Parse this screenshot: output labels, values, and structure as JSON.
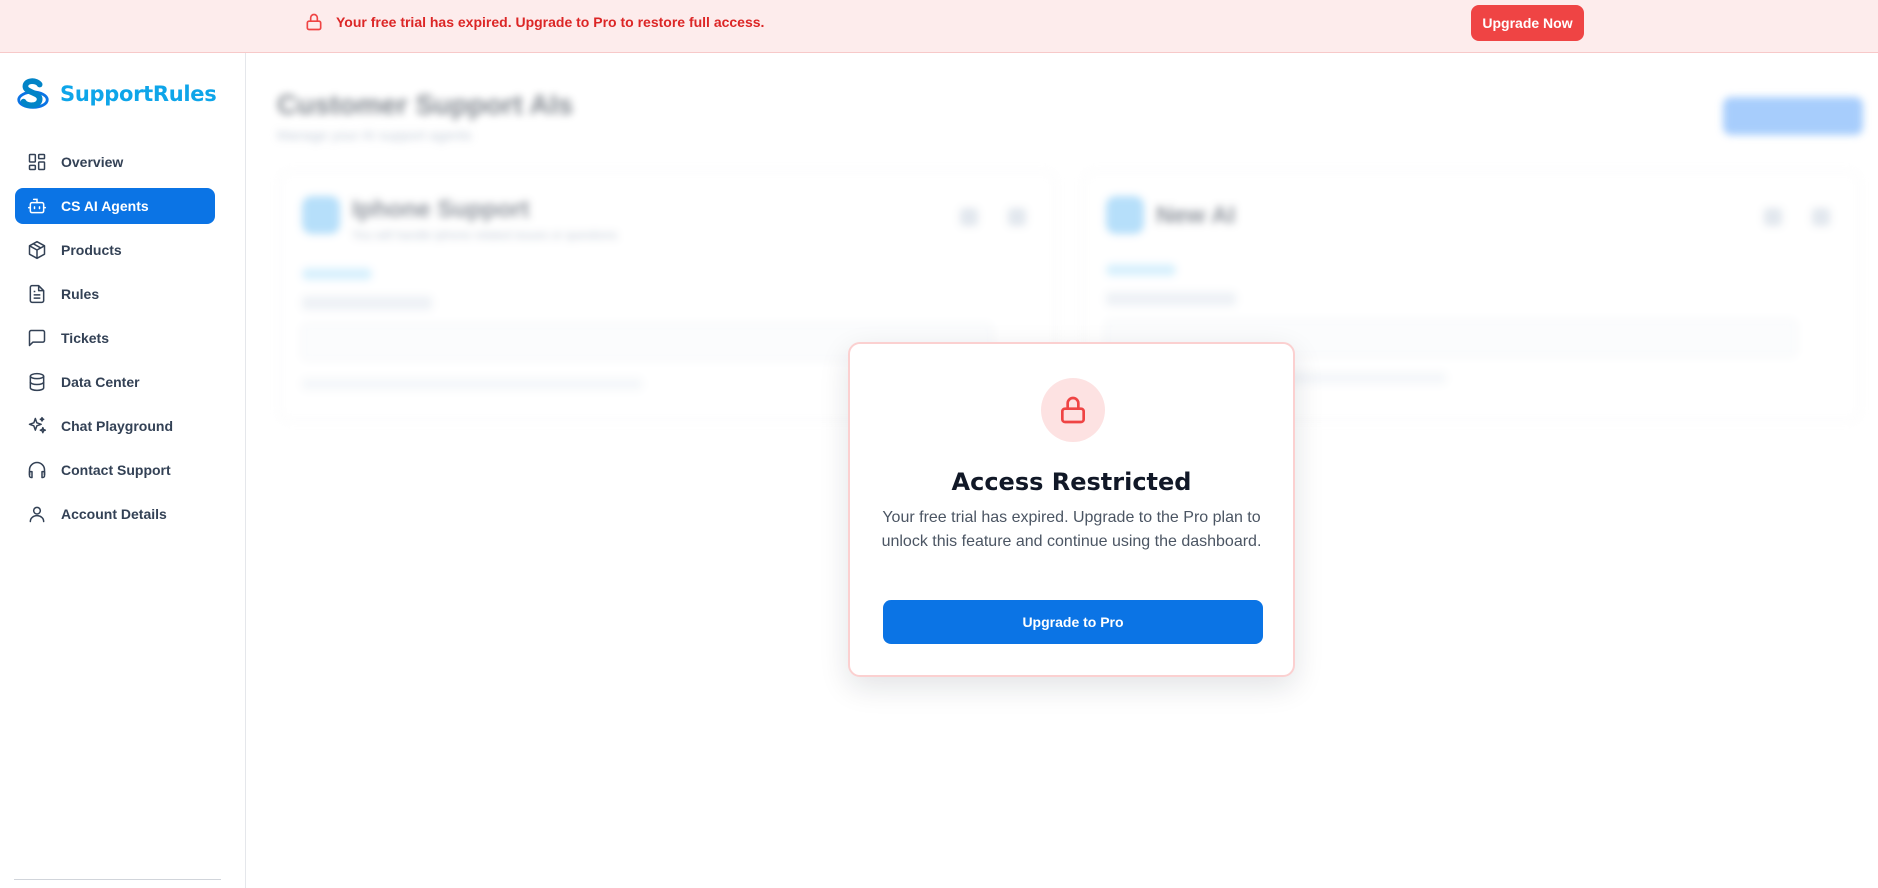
{
  "banner": {
    "message": "Your free trial has expired. Upgrade to Pro to restore full access.",
    "cta_label": "Upgrade Now",
    "color": "#dc2626"
  },
  "brand": {
    "name": "SupportRules",
    "color": "#0ea5e9"
  },
  "sidebar": {
    "items": [
      {
        "label": "Overview",
        "icon": "grid-icon",
        "active": false
      },
      {
        "label": "CS AI Agents",
        "icon": "bot-icon",
        "active": true
      },
      {
        "label": "Products",
        "icon": "box-icon",
        "active": false
      },
      {
        "label": "Rules",
        "icon": "document-icon",
        "active": false
      },
      {
        "label": "Tickets",
        "icon": "chat-bubble-icon",
        "active": false
      },
      {
        "label": "Data Center",
        "icon": "database-icon",
        "active": false
      },
      {
        "label": "Chat Playground",
        "icon": "sparkles-icon",
        "active": false
      },
      {
        "label": "Contact Support",
        "icon": "headphones-icon",
        "active": false
      },
      {
        "label": "Account Details",
        "icon": "user-icon",
        "active": false
      }
    ]
  },
  "main": {
    "title": "Customer Support AIs",
    "subtitle": "Manage your AI support agents",
    "cards": [
      {
        "name": "Iphone Support",
        "description": "You will handle iphone related issues or questions"
      },
      {
        "name": "New AI",
        "description": ""
      }
    ]
  },
  "modal": {
    "title": "Access Restricted",
    "message": "Your free trial has expired. Upgrade to the Pro plan to unlock this feature and continue using the dashboard.",
    "cta_label": "Upgrade to Pro",
    "accent": "#0b74e5",
    "lock_color": "#ef4444"
  }
}
